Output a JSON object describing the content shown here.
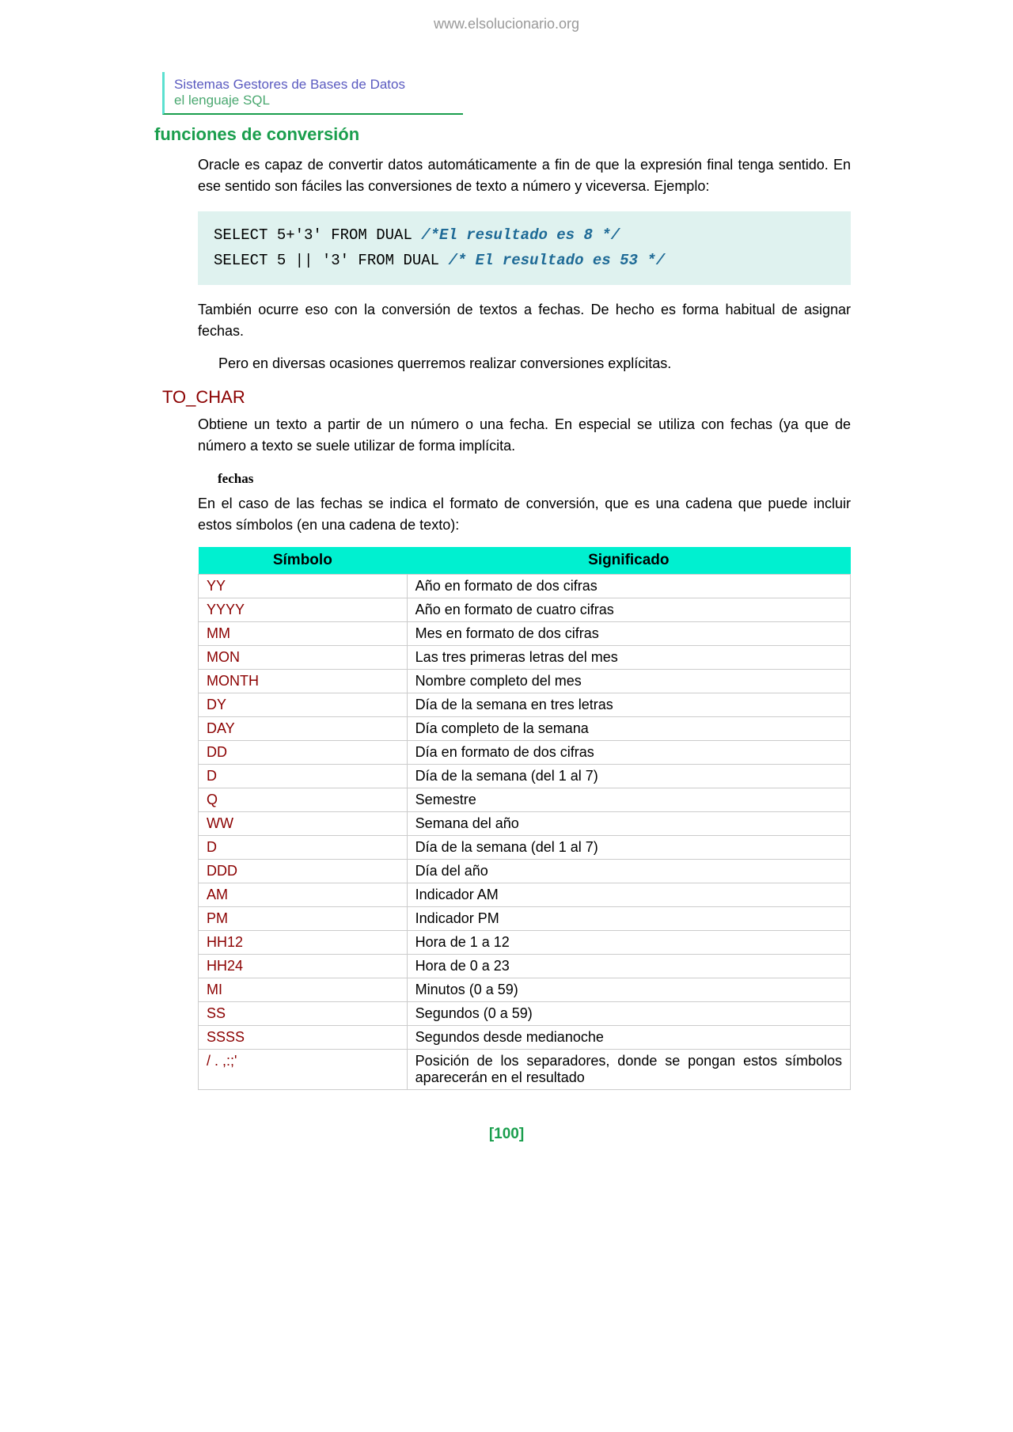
{
  "url": "www.elsolucionario.org",
  "header": {
    "line1": "Sistemas Gestores de Bases de Datos",
    "line2": "el lenguaje SQL"
  },
  "section_title": "funciones de conversión",
  "para1": "Oracle es capaz de convertir datos automáticamente a fin de que la expresión final tenga sentido. En ese sentido son fáciles las conversiones de texto a número y viceversa. Ejemplo:",
  "code": {
    "line1_a": "SELECT 5+'3' FROM DUAL ",
    "line1_b": "/*El resultado es 8 */",
    "line2_a": "SELECT 5 || '3' FROM DUAL ",
    "line2_b": "/* El resultado es 53 */"
  },
  "para2": "También ocurre eso con la conversión de textos a fechas. De hecho es forma habitual de asignar fechas.",
  "para3": "Pero en diversas ocasiones querremos realizar conversiones explícitas.",
  "subsection": "TO_CHAR",
  "para4": "Obtiene un texto a partir de un número o una fecha. En especial se utiliza con fechas (ya que de número a texto se suele utilizar de forma implícita.",
  "sub_heading": "fechas",
  "para5": "En el caso de las fechas se indica el formato de conversión,  que es una cadena que puede incluir estos símbolos (en una cadena de texto):",
  "table": {
    "headers": [
      "Símbolo",
      "Significado"
    ],
    "rows": [
      [
        "YY",
        "Año en formato de dos cifras"
      ],
      [
        "YYYY",
        "Año en formato de cuatro cifras"
      ],
      [
        "MM",
        "Mes en formato de dos cifras"
      ],
      [
        "MON",
        "Las tres primeras letras del mes"
      ],
      [
        "MONTH",
        "Nombre completo del mes"
      ],
      [
        "DY",
        "Día de la semana en tres letras"
      ],
      [
        "DAY",
        "Día completo de la semana"
      ],
      [
        "DD",
        "Día en formato de dos cifras"
      ],
      [
        "D",
        "Día de la semana (del 1 al 7)"
      ],
      [
        "Q",
        "Semestre"
      ],
      [
        "WW",
        "Semana del año"
      ],
      [
        "D",
        "Día de la semana (del 1 al 7)"
      ],
      [
        "DDD",
        "Día del año"
      ],
      [
        "AM",
        "Indicador  AM"
      ],
      [
        "PM",
        "Indicador PM"
      ],
      [
        "HH12",
        "Hora de 1 a 12"
      ],
      [
        "HH24",
        "Hora de 0 a 23"
      ],
      [
        "MI",
        "Minutos (0 a 59)"
      ],
      [
        "SS",
        "Segundos (0 a 59)"
      ],
      [
        "SSSS",
        "Segundos desde medianoche"
      ],
      [
        "/ . ,:;'",
        "Posición de los separadores, donde se pongan estos símbolos aparecerán en el resultado"
      ]
    ]
  },
  "page_number": "[100]"
}
